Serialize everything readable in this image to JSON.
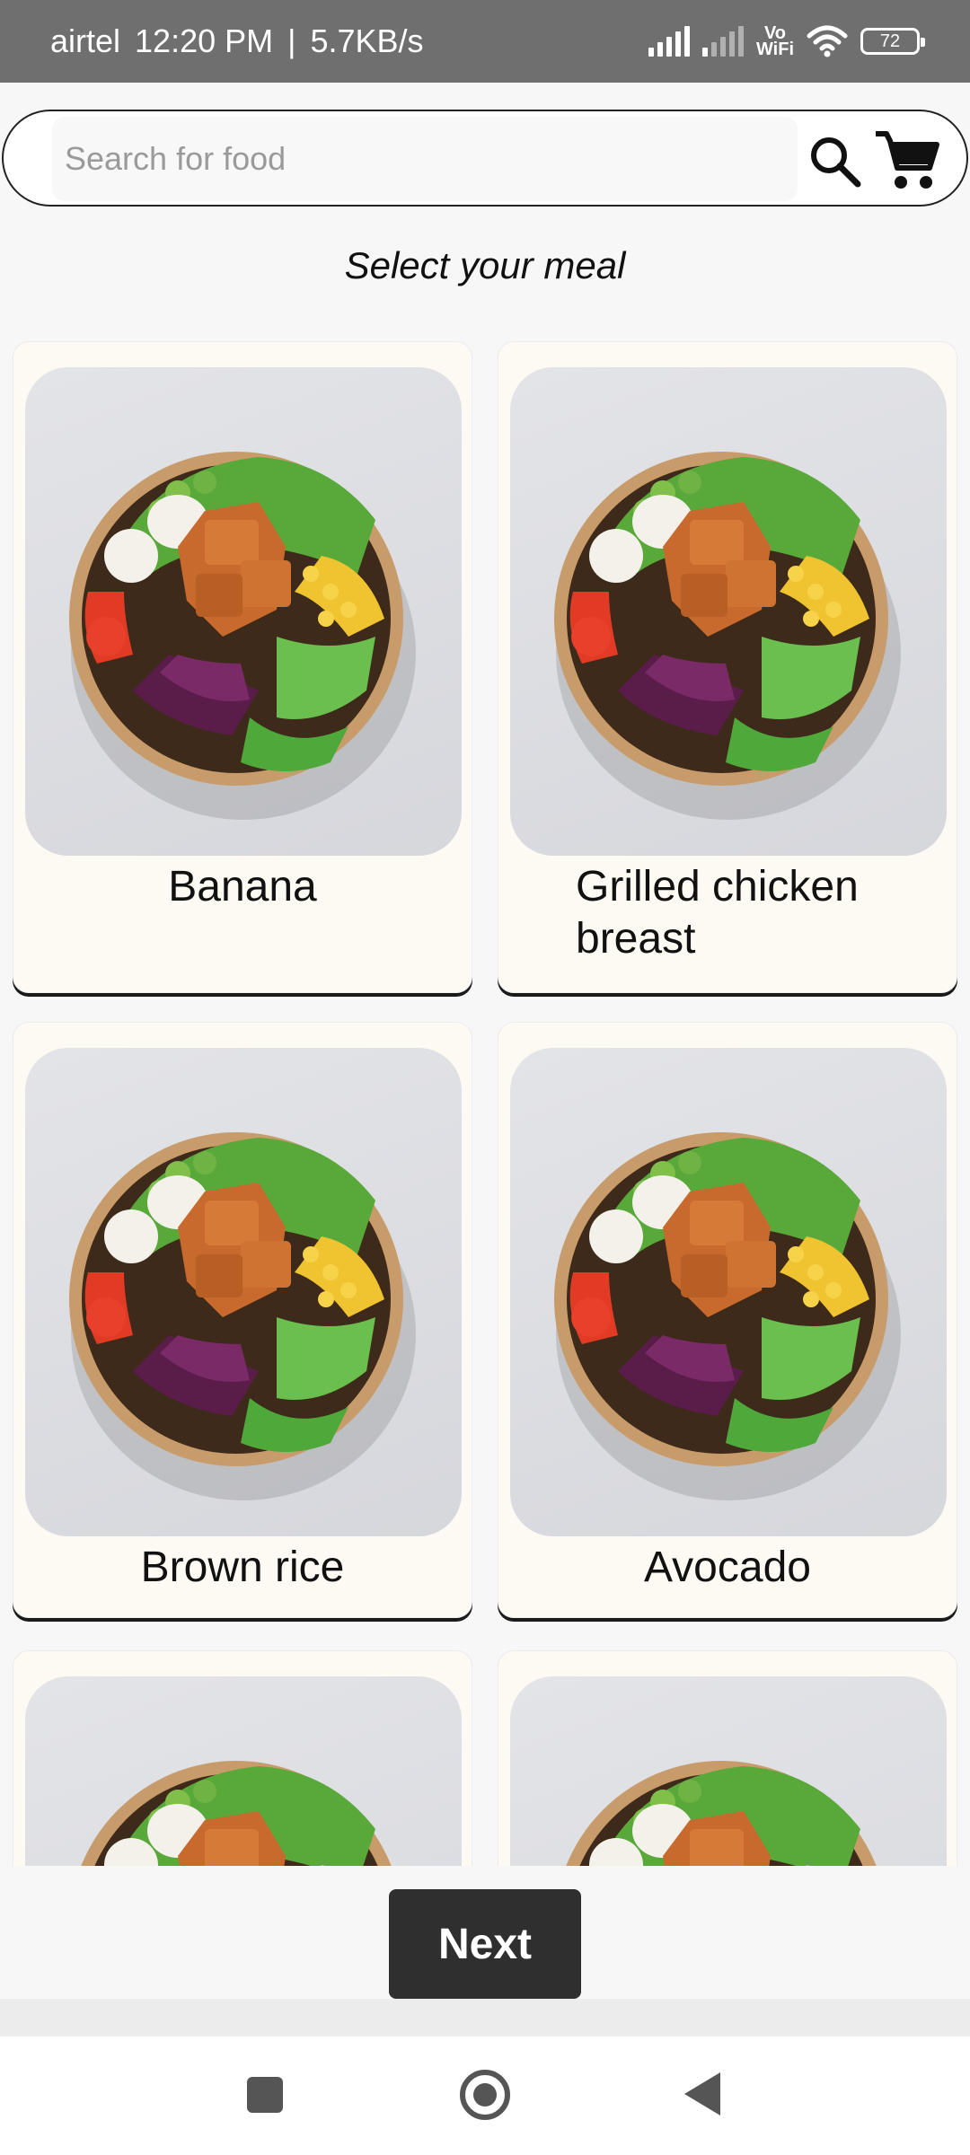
{
  "status_bar": {
    "carrier": "airtel",
    "time": "12:20 PM",
    "separator": "|",
    "speed": "5.7KB/s",
    "volte": "Vo\nWiFi",
    "battery": "72"
  },
  "search": {
    "placeholder": "Search for food",
    "search_icon": "search-icon",
    "cart_icon": "cart-icon"
  },
  "page": {
    "subtitle": "Select your meal"
  },
  "foods": [
    {
      "name": "Banana",
      "image": "salad-bowl"
    },
    {
      "name": "Grilled chicken breast",
      "image": "salad-bowl"
    },
    {
      "name": "Brown rice",
      "image": "salad-bowl"
    },
    {
      "name": "Avocado",
      "image": "salad-bowl"
    },
    {
      "name": "",
      "image": "salad-bowl"
    },
    {
      "name": "",
      "image": "salad-bowl"
    }
  ],
  "actions": {
    "next_label": "Next"
  },
  "nav": {
    "recents": "recents-icon",
    "home": "home-icon",
    "back": "back-icon"
  },
  "colors": {
    "status_bar": "#6f6f6f",
    "card_bg": "#fdfaf3",
    "button_bg": "#2f2f2f"
  }
}
